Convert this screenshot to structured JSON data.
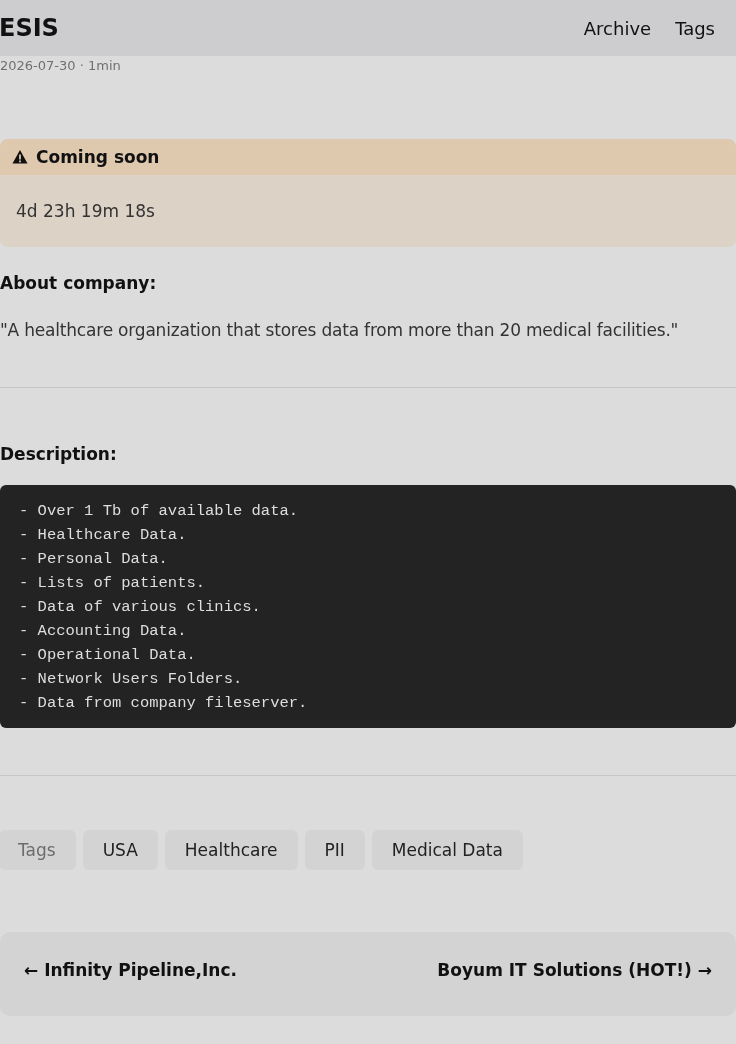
{
  "header": {
    "title": "ESIS",
    "nav": [
      "Archive",
      "Tags"
    ]
  },
  "meta": "2026-07-30 · 1min",
  "alert": {
    "title": "Coming soon",
    "countdown": "4d 23h 19m 18s"
  },
  "about": {
    "heading": "About company:",
    "text": "\"A healthcare organization that stores data from more than 20 medical facilities.\""
  },
  "description": {
    "heading": "Description:",
    "lines": [
      "- Over 1 Tb of available data.",
      "- Healthcare Data.",
      "- Personal Data.",
      "- Lists of patients.",
      "- Data of various clinics.",
      "- Accounting Data.",
      "- Operational Data.",
      "- Network Users Folders.",
      "- Data from company fileserver."
    ]
  },
  "tags": [
    "Tags",
    "USA",
    "Healthcare",
    "PII",
    "Medical Data"
  ],
  "pagination": {
    "prev": "← Infinity Pipeline,Inc.",
    "next": "Boyum IT Solutions (HOT!) →"
  }
}
